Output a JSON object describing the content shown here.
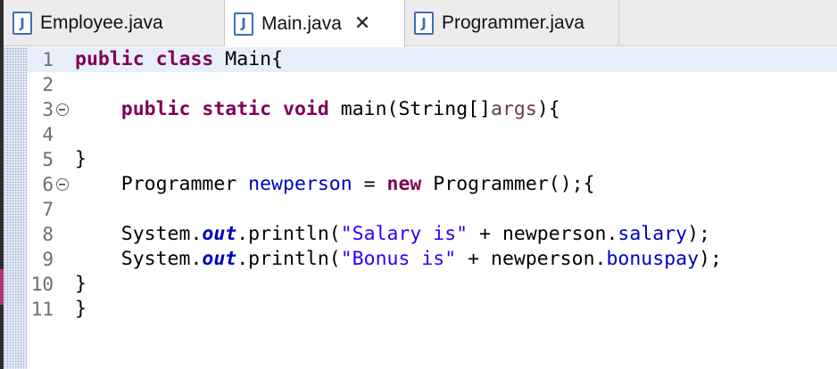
{
  "tabs": [
    {
      "icon": "J",
      "label": "Employee.java",
      "active": false
    },
    {
      "icon": "J",
      "label": "Main.java",
      "active": true,
      "close": "✕"
    },
    {
      "icon": "J",
      "label": "Programmer.java",
      "active": false
    }
  ],
  "editor": {
    "line_numbers": [
      "1",
      "2",
      "3",
      "4",
      "5",
      "6",
      "7",
      "8",
      "9",
      "10",
      "11"
    ],
    "code": {
      "l1": {
        "kw1": "public",
        "kw2": "class",
        "rest": " Main{"
      },
      "l3": {
        "indent": "    ",
        "kw1": "public",
        "kw2": "static",
        "kw3": "void",
        "name": " main(String[]",
        "param": "args",
        "rest": "){"
      },
      "l5": {
        "text": "}"
      },
      "l6": {
        "indent": "    ",
        "type": "Programmer ",
        "var": "newperson",
        "mid": " = ",
        "kw": "new",
        "rest": " Programmer();{"
      },
      "l8": {
        "indent": "    ",
        "sys": "System.",
        "out": "out",
        "call": ".println(",
        "str": "\"Salary is\"",
        "plus": " + newperson.",
        "fld": "salary",
        "end": ");"
      },
      "l9": {
        "indent": "    ",
        "sys": "System.",
        "out": "out",
        "call": ".println(",
        "str": "\"Bonus is\"",
        "plus": " + newperson.",
        "fld": "bonuspay",
        "end": ");"
      },
      "l10": {
        "text": "}"
      },
      "l11": {
        "text": "}"
      }
    }
  },
  "colors": {
    "keyword": "#7f0055",
    "field": "#0000c0",
    "string": "#2a00ff",
    "current_line": "#e8eefa"
  }
}
